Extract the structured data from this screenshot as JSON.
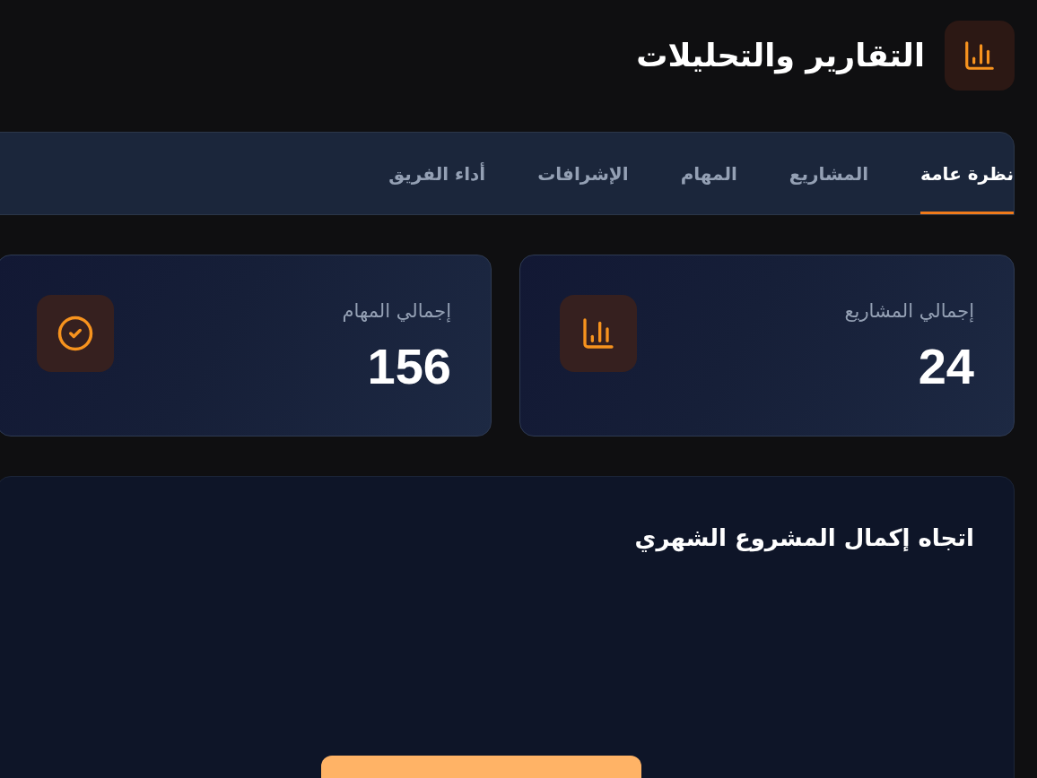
{
  "header": {
    "title": "التقارير والتحليلات"
  },
  "tabs": [
    {
      "label": "نظرة عامة",
      "selected": true
    },
    {
      "label": "المشاريع",
      "selected": false
    },
    {
      "label": "المهام",
      "selected": false
    },
    {
      "label": "الإشرافات",
      "selected": false
    },
    {
      "label": "أداء الفريق",
      "selected": false
    }
  ],
  "stats": [
    {
      "kind": "projects",
      "label": "إجمالي المشاريع",
      "value": "24"
    },
    {
      "kind": "tasks",
      "label": "إجمالي المهام",
      "value": "156"
    }
  ],
  "chart_card": {
    "title": "اتجاه إكمال المشروع الشهري"
  }
}
